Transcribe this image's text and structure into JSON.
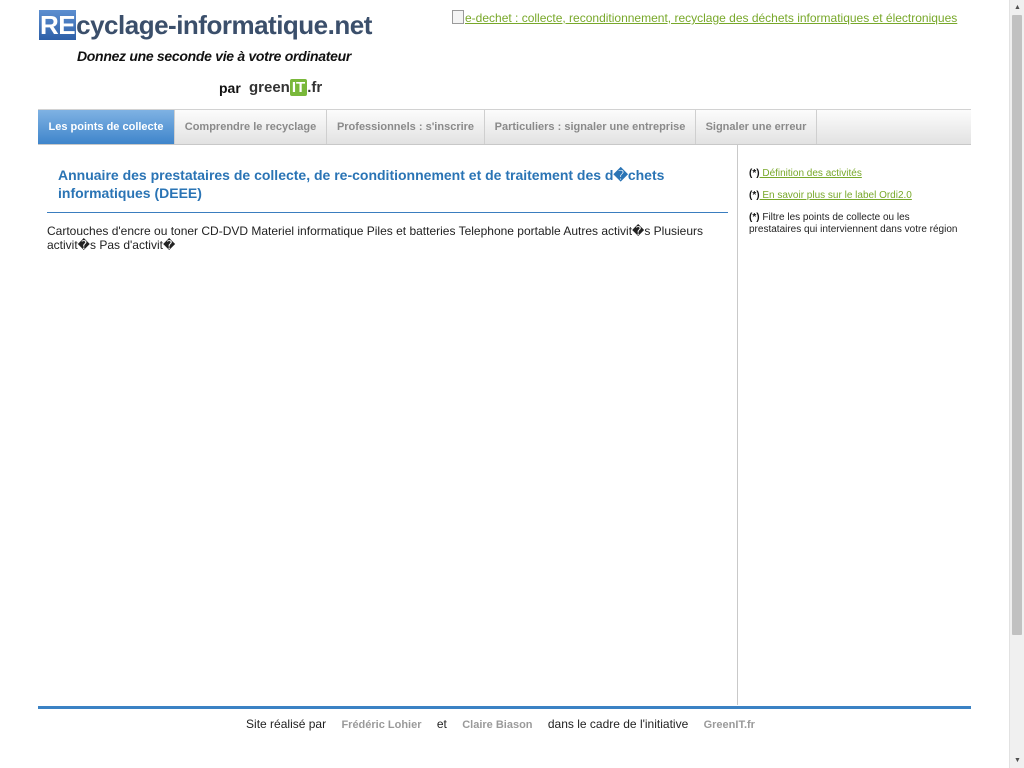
{
  "header": {
    "logo": {
      "prefix": "RE",
      "name": "cyclage-informatique.net",
      "tagline": "Donnez une seconde vie à votre ordinateur",
      "par": "par",
      "green": "green",
      "it": "IT",
      "fr": ".fr"
    },
    "banner_alt": "e-dechet : collecte, reconditionnement, recyclage des déchets informatiques et électroniques"
  },
  "nav": {
    "tabs": [
      {
        "label": "Les points de collecte",
        "active": true
      },
      {
        "label": "Comprendre le recyclage",
        "active": false
      },
      {
        "label": "Professionnels : s'inscrire",
        "active": false
      },
      {
        "label": "Particuliers : signaler une entreprise",
        "active": false
      },
      {
        "label": "Signaler une erreur",
        "active": false
      }
    ]
  },
  "main": {
    "title": "Annuaire des prestataires de collecte, de re-conditionnement et de traitement des d�chets informatiques (DEEE)",
    "activities": "Cartouches d'encre ou toner CD-DVD Materiel informatique Piles et batteries Telephone portable Autres activit�s Plusieurs activit�s Pas d'activit�"
  },
  "sidebar": {
    "star": "(*)",
    "links": [
      {
        "label": " Définition des activités"
      },
      {
        "label": " En savoir plus sur le label Ordi2.0"
      }
    ],
    "note": " Filtre les points de collecte ou les prestataires qui interviennent dans votre région"
  },
  "footer": {
    "made_by": "Site réalisé par",
    "author1": "Frédéric Lohier",
    "and": "et",
    "author2": "Claire Biason",
    "context": "dans le cadre de l'initiative",
    "initiative": "GreenIT.fr"
  },
  "colors": {
    "accent_blue": "#2a74b5",
    "link_green": "#78a82a",
    "nav_active": "#4a8fd0"
  }
}
